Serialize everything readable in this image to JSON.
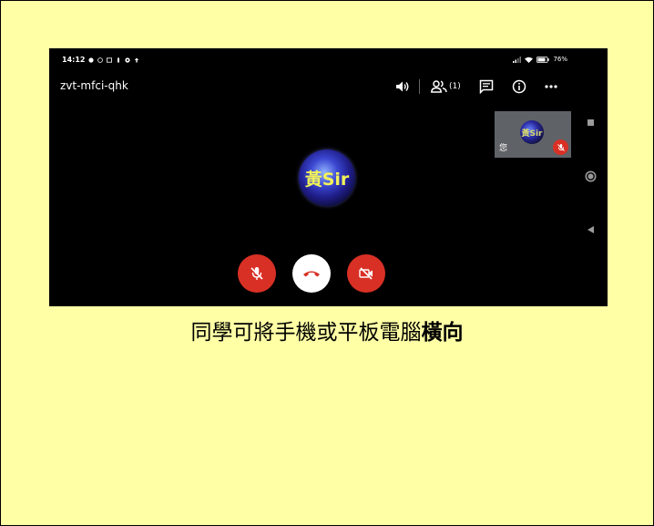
{
  "status_bar": {
    "time": "14:12",
    "battery": "76%"
  },
  "meeting": {
    "code": "zvt-mfci-qhk",
    "participant_count": "(1)"
  },
  "main_avatar": {
    "text": "黃Sir"
  },
  "self_tile": {
    "avatar_text": "黃Sir",
    "label": "您"
  },
  "caption": {
    "normal": "同學可將手機或平板電腦",
    "bold": "橫向"
  },
  "colors": {
    "page_background": "#ffffa6",
    "screen_background": "#000000",
    "control_red": "#d93025",
    "self_tile": "#5f6368"
  },
  "icons": {
    "speaker": "volume-icon",
    "people": "people-icon",
    "chat": "chat-icon",
    "info": "info-icon",
    "more": "more-icon",
    "mic_off": "mic-off-icon",
    "hang_up": "hang-up-icon",
    "camera_off": "camera-off-icon"
  }
}
